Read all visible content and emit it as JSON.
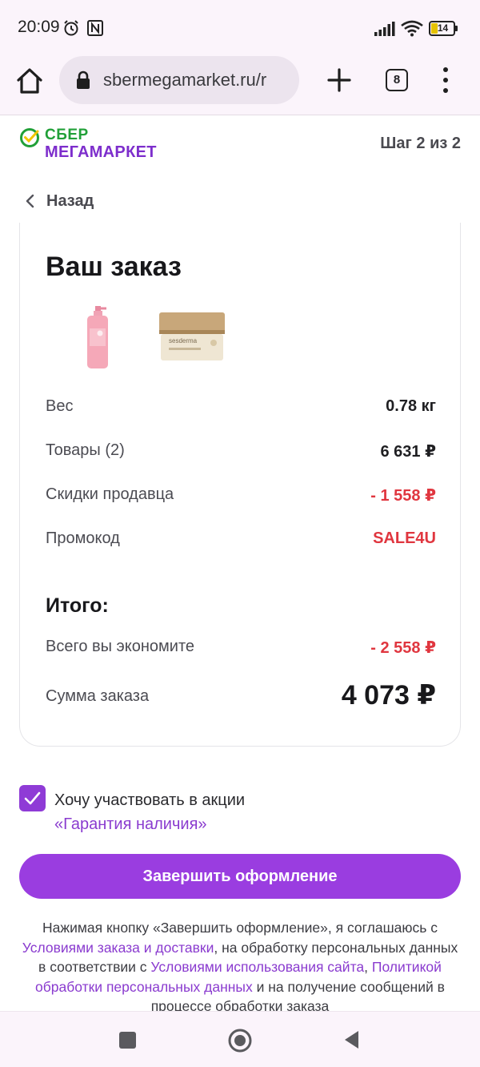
{
  "status_bar": {
    "time": "20:09",
    "battery": "14"
  },
  "browser": {
    "url": "sbermegamarket.ru/r",
    "tab_count": "8"
  },
  "header": {
    "logo_top": "СБЕР",
    "logo_bottom": "МЕГАМАРКЕТ",
    "step": "Шаг 2 из 2",
    "back_label": "Назад"
  },
  "order": {
    "title": "Ваш заказ",
    "rows": [
      {
        "label": "Вес",
        "value": "0.78 кг"
      },
      {
        "label": "Товары (2)",
        "value": "6 631 ₽"
      },
      {
        "label": "Скидки продавца",
        "value": "- 1 558 ₽"
      },
      {
        "label": "Промокод",
        "value": "SALE4U"
      }
    ],
    "total_title": "Итого:",
    "savings_label": "Всего вы экономите",
    "savings_value": "- 2 558 ₽",
    "sum_label": "Сумма заказа",
    "sum_value": "4 073 ₽"
  },
  "promo": {
    "checked": true,
    "text": "Хочу участвовать в акции",
    "link": "«Гарантия наличия»"
  },
  "submit_label": "Завершить оформление",
  "legal": {
    "part1": "Нажимая кнопку «Завершить оформление», я соглашаюсь с ",
    "link1": "Условиями заказа и доставки",
    "part2": ", на обработку персональных данных в соответствии с ",
    "link2": "Условиями использования сайта",
    "part3": ", ",
    "link3": "Политикой обработки персональных данных",
    "part4": " и на получение сообщений в процессе обработки заказа"
  },
  "colors": {
    "accent": "#9a3de0",
    "discount": "#e0363f",
    "brand_green": "#21a038",
    "brand_purple": "#7d2ecc"
  },
  "icons": [
    "alarm-icon",
    "nfc-icon",
    "signal-icon",
    "wifi-icon",
    "battery-icon",
    "home-icon",
    "lock-icon",
    "plus-icon",
    "kebab-menu-icon",
    "chevron-left-icon",
    "check-icon",
    "recents-icon",
    "nav-home-icon",
    "nav-back-icon"
  ]
}
